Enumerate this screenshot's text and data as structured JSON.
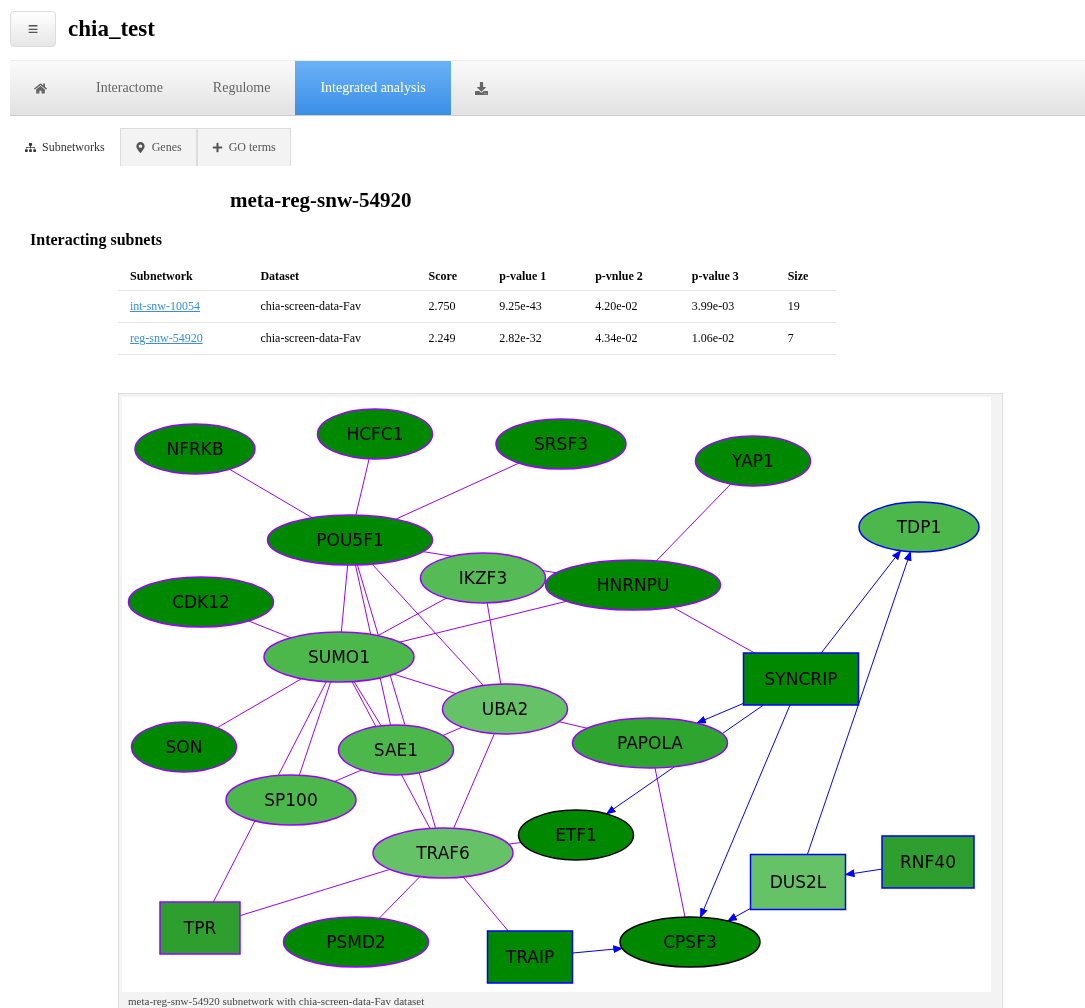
{
  "header": {
    "menu_icon": "≡",
    "title": "chia_test"
  },
  "nav_tabs": [
    {
      "kind": "home",
      "selected": false
    },
    {
      "kind": "text",
      "label": "Interactome",
      "selected": false
    },
    {
      "kind": "text",
      "label": "Regulome",
      "selected": false
    },
    {
      "kind": "text",
      "label": "Integrated analysis",
      "selected": true
    },
    {
      "kind": "download",
      "selected": false
    }
  ],
  "sub_tabs": [
    {
      "kind": "sitemap",
      "label": "Subnetworks",
      "selected": true
    },
    {
      "kind": "marker",
      "label": "Genes",
      "selected": false
    },
    {
      "kind": "plus",
      "label": "GO terms",
      "selected": false
    }
  ],
  "page_title": "meta-reg-snw-54920",
  "section_title": "Interacting subnets",
  "table": {
    "columns": [
      "Subnetwork",
      "Dataset",
      "Score",
      "p-value 1",
      "p-vnlue 2",
      "p-value 3",
      "Size"
    ],
    "rows": [
      [
        "int-snw-10054",
        "chia-screen-data-Fav",
        "2.750",
        "9.25e-43",
        "4.20e-02",
        "3.99e-03",
        "19"
      ],
      [
        "reg-snw-54920",
        "chia-screen-data-Fav",
        "2.249",
        "2.82e-32",
        "4.34e-02",
        "1.06e-02",
        "7"
      ]
    ]
  },
  "network": {
    "caption": "meta-reg-snw-54920 subnetwork with chia-screen-data-Fav dataset",
    "nodes": [
      {
        "label": "NFRKB",
        "kind": "protein",
        "color": "#008800"
      },
      {
        "label": "HCFC1",
        "kind": "protein",
        "color": "#008800"
      },
      {
        "label": "SRSF3",
        "kind": "protein",
        "color": "#008800"
      },
      {
        "label": "YAP1",
        "kind": "protein",
        "color": "#008800"
      },
      {
        "label": "TDP1",
        "kind": "target",
        "color": "#4cb84c"
      },
      {
        "label": "POU5F1",
        "kind": "protein",
        "color": "#008800"
      },
      {
        "label": "IKZF3",
        "kind": "protein",
        "color": "#55bb55"
      },
      {
        "label": "HNRNPU",
        "kind": "protein",
        "color": "#008800"
      },
      {
        "label": "CDK12",
        "kind": "protein",
        "color": "#008800"
      },
      {
        "label": "SUMO1",
        "kind": "protein",
        "color": "#4cb84c"
      },
      {
        "label": "SYNCRIP",
        "kind": "regulator",
        "color": "#008800"
      },
      {
        "label": "UBA2",
        "kind": "protein",
        "color": "#66c266"
      },
      {
        "label": "SON",
        "kind": "protein",
        "color": "#008800"
      },
      {
        "label": "SAE1",
        "kind": "protein",
        "color": "#4cb84c"
      },
      {
        "label": "PAPOLA",
        "kind": "protein",
        "color": "#2ea52e"
      },
      {
        "label": "SP100",
        "kind": "protein",
        "color": "#4cb84c"
      },
      {
        "label": "ETF1",
        "kind": "endpoint",
        "color": "#008800"
      },
      {
        "label": "TRAF6",
        "kind": "protein",
        "color": "#66c266"
      },
      {
        "label": "DUS2L",
        "kind": "regulator",
        "color": "#66c266"
      },
      {
        "label": "RNF40",
        "kind": "regulator",
        "color": "#2e9e2e"
      },
      {
        "label": "TPR",
        "kind": "anchor",
        "color": "#2e9e2e"
      },
      {
        "label": "PSMD2",
        "kind": "protein",
        "color": "#008800"
      },
      {
        "label": "TRAIP",
        "kind": "regulator",
        "color": "#008800"
      },
      {
        "label": "CPSF3",
        "kind": "endpoint",
        "color": "#008800"
      }
    ]
  }
}
